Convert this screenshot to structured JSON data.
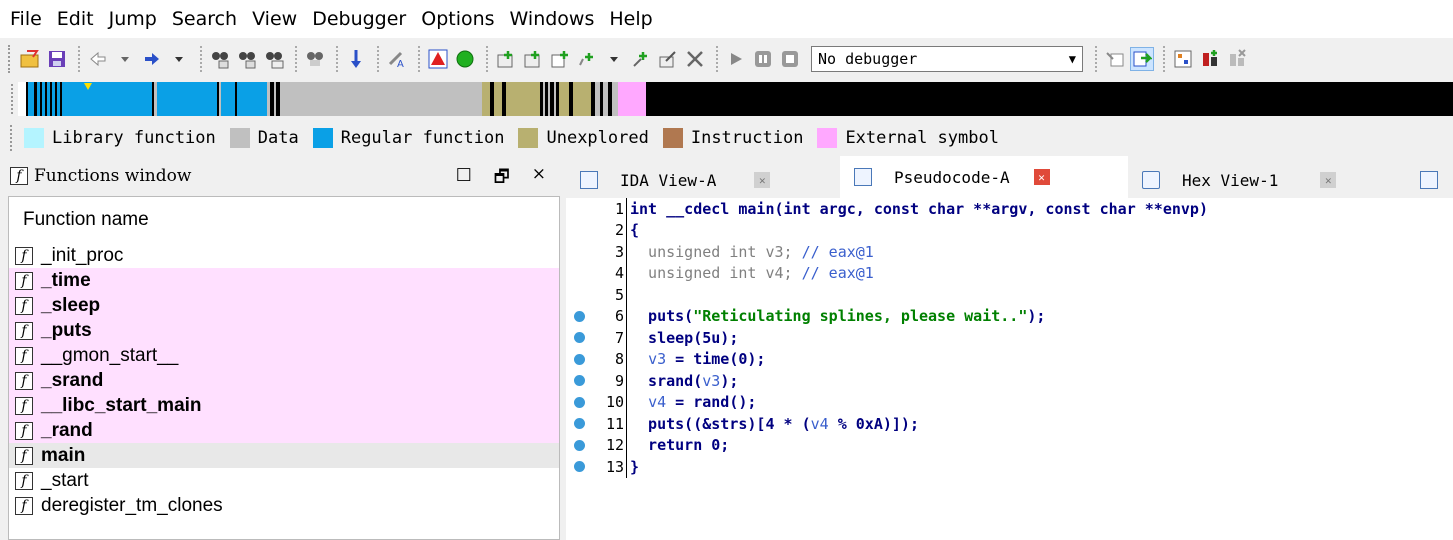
{
  "menu": [
    "File",
    "Edit",
    "Jump",
    "Search",
    "View",
    "Debugger",
    "Options",
    "Windows",
    "Help"
  ],
  "toolbar": {
    "debugger_select": "No debugger",
    "icons": [
      "open-icon",
      "save-icon",
      "back-icon",
      "back-dropdown-icon",
      "forward-icon",
      "forward-dropdown-icon",
      "search-text-icon",
      "search-next-icon",
      "search-binary-icon",
      "search-immediate-icon",
      "jump-icon",
      "string-icon",
      "warning-icon",
      "green-circle-icon",
      "add-struct-icon",
      "add-enum-icon",
      "add-type-icon",
      "add-func-icon",
      "dropdown-icon",
      "delete-func-icon",
      "edit-func-icon",
      "close-icon",
      "play-icon",
      "pause-icon",
      "stop-icon",
      "dropdown-icon",
      "breakpoint-icon",
      "step-icon",
      "graph-icon",
      "plugin-icon",
      "disable-icon"
    ]
  },
  "colors": {
    "library": "#a8f0ff",
    "data": "#c0c0c0",
    "regular": "#0aa0e6",
    "unexplored": "#b8b070",
    "instruction": "#b07850",
    "external": "#ffa8ff"
  },
  "legend": [
    {
      "label": "Library function",
      "color": "#b4f4ff"
    },
    {
      "label": "Data",
      "color": "#c0c0c0"
    },
    {
      "label": "Regular function",
      "color": "#0aa0e6"
    },
    {
      "label": "Unexplored",
      "color": "#b8b070"
    },
    {
      "label": "Instruction",
      "color": "#b07850"
    },
    {
      "label": "External symbol",
      "color": "#ffa8ff"
    }
  ],
  "functions_window": {
    "title": "Functions window",
    "controls": [
      "□",
      "🗗",
      "×"
    ],
    "column_header": "Function name",
    "rows": [
      {
        "name": "_init_proc",
        "style": "plain"
      },
      {
        "name": "_time",
        "style": "pink"
      },
      {
        "name": "_sleep",
        "style": "pink"
      },
      {
        "name": "_puts",
        "style": "pink"
      },
      {
        "name": "__gmon_start__",
        "style": "pinkplain"
      },
      {
        "name": "_srand",
        "style": "pink"
      },
      {
        "name": "__libc_start_main",
        "style": "pink"
      },
      {
        "name": "_rand",
        "style": "pink"
      },
      {
        "name": "main",
        "style": "sel"
      },
      {
        "name": "_start",
        "style": "plain"
      },
      {
        "name": "deregister_tm_clones",
        "style": "plain"
      }
    ]
  },
  "tabs": [
    {
      "label": "IDA View-A",
      "active": false
    },
    {
      "label": "Pseudocode-A",
      "active": true
    },
    {
      "label": "Hex View-1",
      "active": false
    }
  ],
  "code": {
    "lines": [
      {
        "n": "1",
        "dot": false,
        "text": "int __cdecl main(int argc, const char **argv, const char **envp)"
      },
      {
        "n": "2",
        "dot": false,
        "text": "{"
      },
      {
        "n": "3",
        "dot": false,
        "text": "  unsigned int v3; ",
        "comment": "// eax@1"
      },
      {
        "n": "4",
        "dot": false,
        "text": "  unsigned int v4; ",
        "comment": "// eax@1"
      },
      {
        "n": "5",
        "dot": false,
        "text": ""
      },
      {
        "n": "6",
        "dot": true,
        "text": "  puts(",
        "string": "\"Reticulating splines, please wait..\"",
        "tail": ");"
      },
      {
        "n": "7",
        "dot": true,
        "text": "  sleep(5u);"
      },
      {
        "n": "8",
        "dot": true,
        "var": "v3",
        "text": " = time(0);"
      },
      {
        "n": "9",
        "dot": true,
        "text": "  srand(",
        "var2": "v3",
        "tail": ");"
      },
      {
        "n": "10",
        "dot": true,
        "var": "v4",
        "text": " = rand();"
      },
      {
        "n": "11",
        "dot": true,
        "text": "  puts((&strs)[4 * (",
        "var2": "v4",
        "tail": " % 0xA)]);"
      },
      {
        "n": "12",
        "dot": true,
        "text": "  return 0;"
      },
      {
        "n": "13",
        "dot": true,
        "text": "}"
      }
    ]
  }
}
